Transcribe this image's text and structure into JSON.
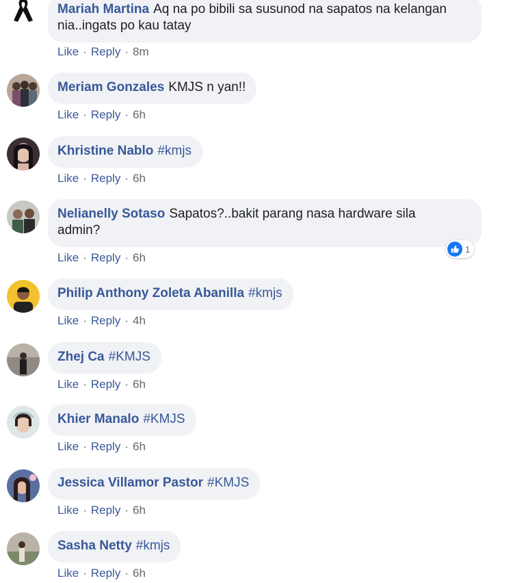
{
  "actions": {
    "like": "Like",
    "reply": "Reply",
    "separator": "·"
  },
  "comments": [
    {
      "author": "Mariah Martina",
      "line1": "Aq na po bibili sa susunod na sapatos na kelangan",
      "line2": "nia..ingats po kau tatay",
      "time": "8m",
      "avatar_icon": "black-ribbon-icon"
    },
    {
      "author": "Meriam Gonzales",
      "text": "KMJS n yan!!",
      "time": "6h",
      "avatar_icon": "profile-photo"
    },
    {
      "author": "Khristine Nablo",
      "hashtag": "#kmjs",
      "time": "6h",
      "avatar_icon": "profile-photo"
    },
    {
      "author": "Nelianelly Sotaso",
      "line1": "Sapatos?..bakit parang nasa hardware sila",
      "line2": "admin?",
      "time": "6h",
      "avatar_icon": "profile-photo",
      "reaction": {
        "icon": "like-icon",
        "count": "1"
      }
    },
    {
      "author": "Philip Anthony Zoleta Abanilla",
      "hashtag": "#kmjs",
      "time": "4h",
      "avatar_icon": "profile-photo"
    },
    {
      "author": "Zhej Ca",
      "hashtag": "#KMJS",
      "time": "6h",
      "avatar_icon": "profile-photo"
    },
    {
      "author": "Khier Manalo",
      "hashtag": "#KMJS",
      "time": "6h",
      "avatar_icon": "profile-photo"
    },
    {
      "author": "Jessica Villamor Pastor",
      "hashtag": "#KMJS",
      "time": "6h",
      "avatar_icon": "profile-photo"
    },
    {
      "author": "Sasha Netty",
      "hashtag": "#kmjs",
      "time": "6h",
      "avatar_icon": "profile-photo"
    }
  ],
  "colors": {
    "link": "#385898",
    "bubble": "#f0f2f5",
    "text": "#1c1e21",
    "meta": "#65676b",
    "like_badge": "#1877f2"
  }
}
